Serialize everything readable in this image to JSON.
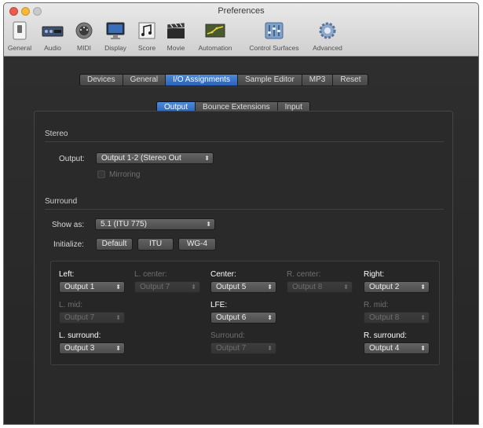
{
  "window": {
    "title": "Preferences"
  },
  "toolbar": {
    "items": [
      {
        "label": "General",
        "icon": "general-switch-icon"
      },
      {
        "label": "Audio",
        "icon": "audio-interface-icon"
      },
      {
        "label": "MIDI",
        "icon": "midi-connector-icon"
      },
      {
        "label": "Display",
        "icon": "display-monitor-icon"
      },
      {
        "label": "Score",
        "icon": "score-notes-icon"
      },
      {
        "label": "Movie",
        "icon": "movie-clapper-icon"
      },
      {
        "label": "Automation",
        "icon": "automation-curve-icon"
      },
      {
        "label": "Control Surfaces",
        "icon": "control-surface-faders-icon"
      },
      {
        "label": "Advanced",
        "icon": "advanced-gear-icon"
      }
    ]
  },
  "audio_tabs": {
    "items": [
      "Devices",
      "General",
      "I/O Assignments",
      "Sample Editor",
      "MP3",
      "Reset"
    ],
    "selected": "I/O Assignments"
  },
  "io_tabs": {
    "items": [
      "Output",
      "Bounce Extensions",
      "Input"
    ],
    "selected": "Output"
  },
  "stereo": {
    "header": "Stereo",
    "output_label": "Output:",
    "output_value": "Output 1-2  (Stereo Out",
    "mirroring_label": "Mirroring",
    "mirroring_checked": false
  },
  "surround": {
    "header": "Surround",
    "show_as_label": "Show as:",
    "show_as_value": "5.1 (ITU 775)",
    "initialize_label": "Initialize:",
    "buttons": [
      "Default",
      "ITU",
      "WG-4"
    ],
    "channels": {
      "left": {
        "label": "Left:",
        "value": "Output 1"
      },
      "l_center": {
        "label": "L. center:",
        "value": "Output 7"
      },
      "center": {
        "label": "Center:",
        "value": "Output 5"
      },
      "r_center": {
        "label": "R. center:",
        "value": "Output 8"
      },
      "right": {
        "label": "Right:",
        "value": "Output 2"
      },
      "l_mid": {
        "label": "L. mid:",
        "value": "Output 7"
      },
      "lfe": {
        "label": "LFE:",
        "value": "Output 6"
      },
      "r_mid": {
        "label": "R. mid:",
        "value": "Output 8"
      },
      "l_surround": {
        "label": "L. surround:",
        "value": "Output 3"
      },
      "surround": {
        "label": "Surround:",
        "value": "Output 7"
      },
      "r_surround": {
        "label": "R. surround:",
        "value": "Output 4"
      }
    }
  },
  "glyphs": {
    "popup_arrows": "⬍"
  },
  "colors": {
    "selected_tab": "#2c62b4",
    "background": "#2c2c2c"
  }
}
